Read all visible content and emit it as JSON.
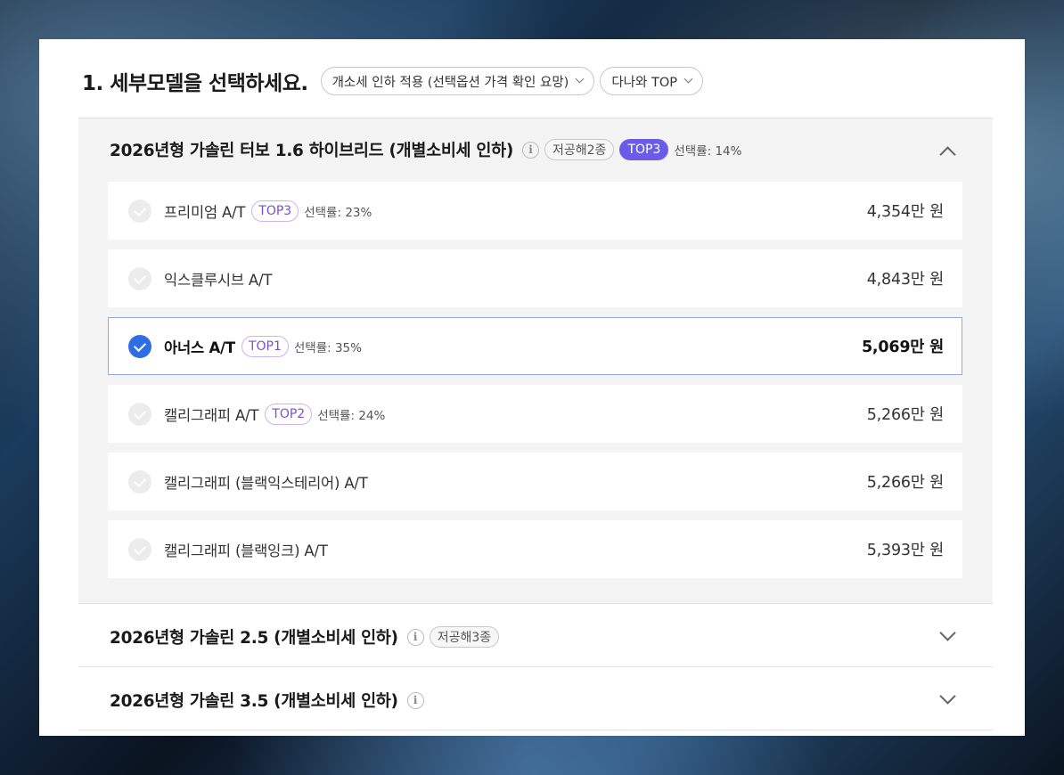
{
  "page_title": "1. 세부모델을 선택하세요.",
  "filters": [
    {
      "label": "개소세 인하 적용 (선택옵션 가격 확인 요망)"
    },
    {
      "label": "다나와 TOP"
    }
  ],
  "groups": [
    {
      "title": "2026년형 가솔린 터보 1.6 하이브리드 (개별소비세 인하)",
      "eco_tag": "저공해2종",
      "top_tag": "TOP3",
      "rate": "선택률: 14%",
      "expanded": true,
      "models": [
        {
          "name": "프리미엄 A/T",
          "top": "TOP3",
          "rate": "선택률: 23%",
          "price": "4,354만 원",
          "selected": false
        },
        {
          "name": "익스클루시브 A/T",
          "top": "",
          "rate": "",
          "price": "4,843만 원",
          "selected": false
        },
        {
          "name": "아너스 A/T",
          "top": "TOP1",
          "rate": "선택률: 35%",
          "price": "5,069만 원",
          "selected": true
        },
        {
          "name": "캘리그래피 A/T",
          "top": "TOP2",
          "rate": "선택률: 24%",
          "price": "5,266만 원",
          "selected": false
        },
        {
          "name": "캘리그래피 (블랙익스테리어) A/T",
          "top": "",
          "rate": "",
          "price": "5,266만 원",
          "selected": false
        },
        {
          "name": "캘리그래피 (블랙잉크) A/T",
          "top": "",
          "rate": "",
          "price": "5,393만 원",
          "selected": false
        }
      ]
    },
    {
      "title": "2026년형 가솔린 2.5 (개별소비세 인하)",
      "eco_tag": "저공해3종",
      "expanded": false
    },
    {
      "title": "2026년형 가솔린 3.5 (개별소비세 인하)",
      "eco_tag": "",
      "expanded": false
    }
  ],
  "icons": {
    "info": "i",
    "check": "check-icon",
    "expand": "chevron-down-icon",
    "collapse": "chevron-up-icon"
  },
  "colors": {
    "accent_blue": "#2f6de5",
    "top_purple": "#6b5ce7",
    "top_outline_text": "#7a4fd6"
  }
}
